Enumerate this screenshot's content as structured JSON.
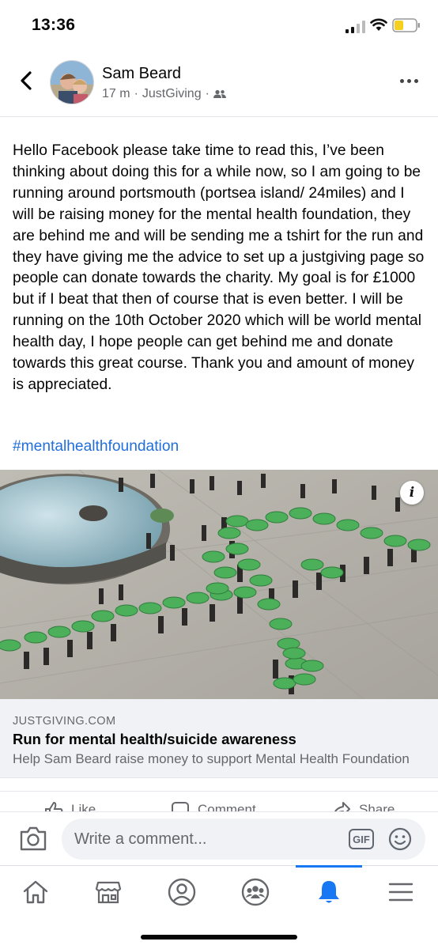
{
  "status_bar": {
    "time": "13:36"
  },
  "header": {
    "author": "Sam Beard",
    "time_ago": "17 m",
    "separator": "·",
    "source": "JustGiving",
    "audience_icon": "friends-icon"
  },
  "post": {
    "text": "Hello Facebook please take time to read this, I’ve been thinking about doing this for a while now, so I am going to be running around portsmouth (portsea island/ 24miles) and I will be raising money for the mental health foundation, they are behind me and will be sending me a tshirt for the run and they have giving me the advice to set up a justgiving page so people can donate towards the charity. My goal is for £1000 but if I beat that then of course that is even better. I will be running on the 10th October 2020 which will be world mental health day, I hope people can get behind me and donate towards this great course.  Thank you and amount of money is appreciated.",
    "hashtag": "#mentalhealthfoundation"
  },
  "link_card": {
    "domain": "JUSTGIVING.COM",
    "title": "Run for mental health/suicide awareness",
    "description": "Help Sam Beard raise money to support Mental Health Foundation"
  },
  "actions": {
    "like": "Like",
    "comment": "Comment",
    "share": "Share"
  },
  "comment_bar": {
    "placeholder": "Write a comment...",
    "gif_label": "GIF"
  },
  "tab_bar": {
    "tabs": [
      "home-icon",
      "marketplace-icon",
      "profile-icon",
      "groups-icon",
      "notifications-icon",
      "menu-icon"
    ],
    "active": "notifications-icon"
  },
  "colors": {
    "link_blue": "#216fdb",
    "accent": "#1877f2",
    "umbrella_green": "#4caf5a",
    "battery_yellow": "#f5d020"
  }
}
